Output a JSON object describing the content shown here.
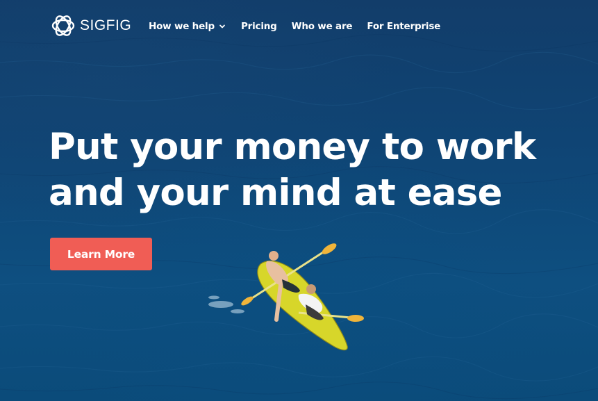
{
  "brand": {
    "name": "SIGFIG",
    "logo_icon": "interlocking-rings-logo-icon"
  },
  "nav": {
    "items": [
      {
        "label": "How we help",
        "has_dropdown": true,
        "icon": "chevron-down-icon"
      },
      {
        "label": "Pricing"
      },
      {
        "label": "Who we are"
      },
      {
        "label": "For Enterprise"
      }
    ]
  },
  "hero": {
    "headline_line1": "Put your money to work",
    "headline_line2": "and your mind at ease",
    "cta_label": "Learn More",
    "background_photo": "aerial ocean with two people in a yellow kayak"
  },
  "colors": {
    "ocean": "#0e4f80",
    "cta": "#f05d55",
    "text": "#ffffff",
    "kayak": "#d7d62a"
  }
}
